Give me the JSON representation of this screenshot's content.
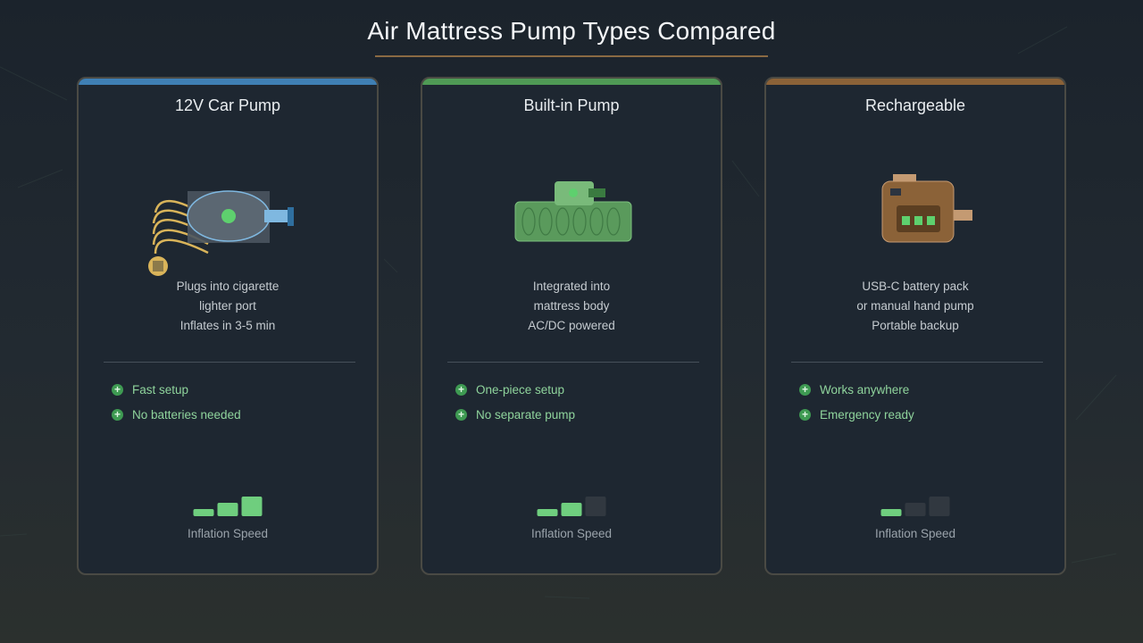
{
  "title": "Air Mattress Pump Types Compared",
  "colors": {
    "accent_blue": "#3f7fb4",
    "accent_green": "#4f9a55",
    "accent_brown": "#8b6238",
    "meter_on": "#6fce7e",
    "meter_off": "#313840",
    "pro_text": "#8fd49c"
  },
  "cards": [
    {
      "title": "12V Car Pump",
      "icon": "car-pump-icon",
      "desc": [
        "Plugs into cigarette",
        "lighter port",
        "Inflates in 3-5 min"
      ],
      "pros": [
        "Fast setup",
        "No batteries needed"
      ],
      "speed_level": 3,
      "speed_max": 3,
      "meter_label": "Inflation Speed"
    },
    {
      "title": "Built-in Pump",
      "icon": "built-in-pump-icon",
      "desc": [
        "Integrated into",
        "mattress body",
        "AC/DC powered"
      ],
      "pros": [
        "One-piece setup",
        "No separate pump"
      ],
      "speed_level": 2,
      "speed_max": 3,
      "meter_label": "Inflation Speed"
    },
    {
      "title": "Rechargeable",
      "icon": "rechargeable-pump-icon",
      "desc": [
        "USB-C battery pack",
        "or manual hand pump",
        "Portable backup"
      ],
      "pros": [
        "Works anywhere",
        "Emergency ready"
      ],
      "speed_level": 1,
      "speed_max": 3,
      "meter_label": "Inflation Speed"
    }
  ]
}
